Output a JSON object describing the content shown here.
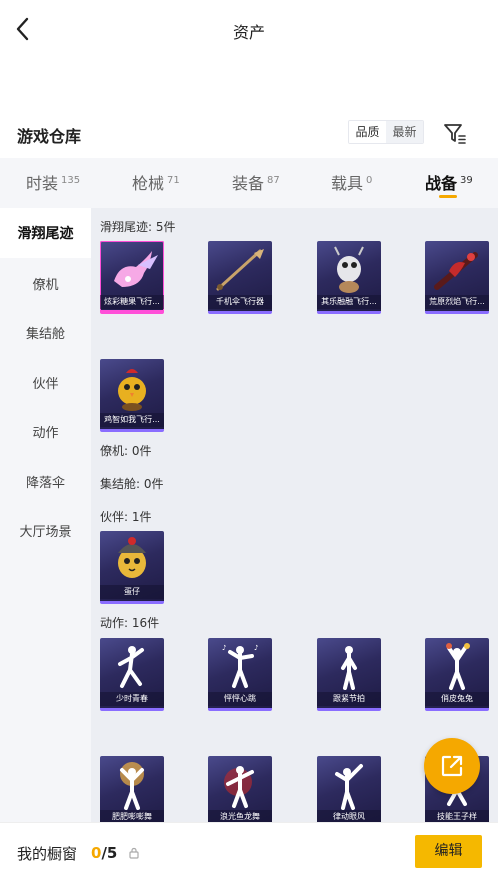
{
  "header": {
    "title": "资产",
    "back_icon": "chevron-left-icon"
  },
  "warehouse": {
    "title": "游戏仓库",
    "sort_quality": "品质",
    "sort_newest": "最新",
    "filter_icon": "filter-icon"
  },
  "tabs": [
    {
      "label": "时装",
      "count": "135"
    },
    {
      "label": "枪械",
      "count": "71"
    },
    {
      "label": "装备",
      "count": "87"
    },
    {
      "label": "载具",
      "count": "0"
    },
    {
      "label": "战备",
      "count": "39",
      "active": true
    }
  ],
  "sidebar": [
    {
      "label": "滑翔尾迹",
      "active": true
    },
    {
      "label": "僚机"
    },
    {
      "label": "集结舱"
    },
    {
      "label": "伙伴"
    },
    {
      "label": "动作"
    },
    {
      "label": "降落伞"
    },
    {
      "label": "大厅场景"
    }
  ],
  "groups": {
    "glide": {
      "label": "滑翔尾迹: 5件",
      "items": [
        "炫彩糖果飞行...",
        "千机伞飞行器",
        "其乐融融飞行...",
        "荒原烈焰飞行...",
        "鸡智如我飞行..."
      ]
    },
    "wingman": {
      "label": "僚机: 0件"
    },
    "pod": {
      "label": "集结舱: 0件"
    },
    "partner": {
      "label": "伙伴: 1件",
      "items": [
        "蛋仔"
      ]
    },
    "emote": {
      "label": "动作: 16件",
      "items": [
        "少时青春",
        "怦怦心跳",
        "跟紧节拍",
        "俏皮兔兔",
        "肥肥嘭嘭舞",
        "浪光鱼龙舞",
        "律动眼风",
        "技能王子样"
      ]
    }
  },
  "bottom": {
    "label": "我的橱窗",
    "count_current": "0",
    "count_total": "/5",
    "edit": "编辑",
    "lock_icon": "lock-icon",
    "share_icon": "share-external-icon"
  },
  "colors": {
    "accent": "#f5a800",
    "card_dark": "#2d2a5e",
    "pink_rarity": "#ff4fd8",
    "purple_rarity": "#8a6dff"
  }
}
